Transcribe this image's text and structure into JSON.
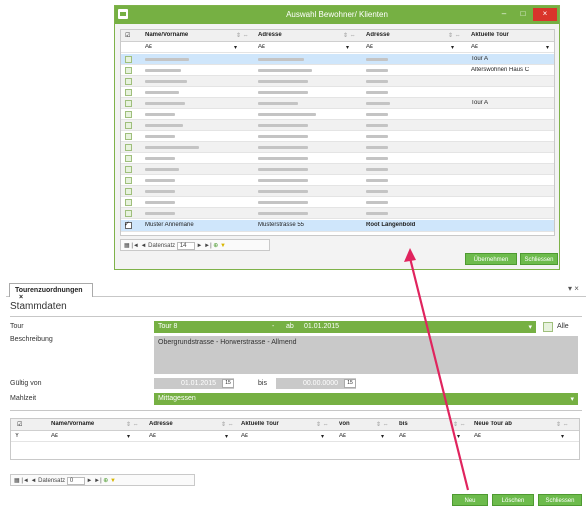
{
  "dialog": {
    "title": "Auswahl Bewohner/ Klienten",
    "min_label": "–",
    "max_label": "□",
    "close_label": "×",
    "columns": [
      "Name/Vorname",
      "Adresse",
      "Adresse",
      "Aktuelle Tour"
    ],
    "filter_symbol": "Aᴇ",
    "rows_tour": [
      "Tour A",
      "Alterswohnen Haus C",
      "",
      "",
      "",
      "",
      "Tour A",
      "",
      "",
      "",
      "",
      "",
      "",
      "",
      "",
      ""
    ],
    "selected_row": {
      "name": "Muster Annemarie",
      "address": "Musterstrasse 55",
      "address2": "Root Längenbold"
    },
    "nav": {
      "label": "Datensatz",
      "value": "14"
    },
    "ok_button": "Übernehmen",
    "close_button": "Schliessen"
  },
  "form": {
    "tab_label": "Tourenzuordnungen",
    "tab_close": "×",
    "pin_label": "▾ ×",
    "section": "Stammdaten",
    "tour_label": "Tour",
    "tour_value": "Tour 8",
    "tour_dash": "-",
    "tour_ab": "ab",
    "tour_date": "01.01.2015",
    "alle_label": "Alle",
    "beschreibung_label": "Beschreibung",
    "beschreibung_value": "Obergrundstrasse - Horwerstrasse - Allmend",
    "gueltig_label": "Gültig von",
    "gueltig_von": "01.01.2015",
    "bis_label": "bis",
    "gueltig_bis": "00.00.0000",
    "mahlzeit_label": "Mahlzeit",
    "mahlzeit_value": "Mittagessen",
    "columns": [
      "Name/Vorname",
      "Adresse",
      "Aktuelle Tour",
      "von",
      "bis",
      "Neue Tour ab"
    ],
    "filter_symbol": "Aᴇ",
    "nav": {
      "label": "Datensatz",
      "value": "0"
    },
    "neu_button": "Neu",
    "loeschen_button": "Löschen",
    "schliessen_button": "Schliessen"
  },
  "colors": {
    "accent": "#76b043",
    "arrow": "#e0245e"
  }
}
